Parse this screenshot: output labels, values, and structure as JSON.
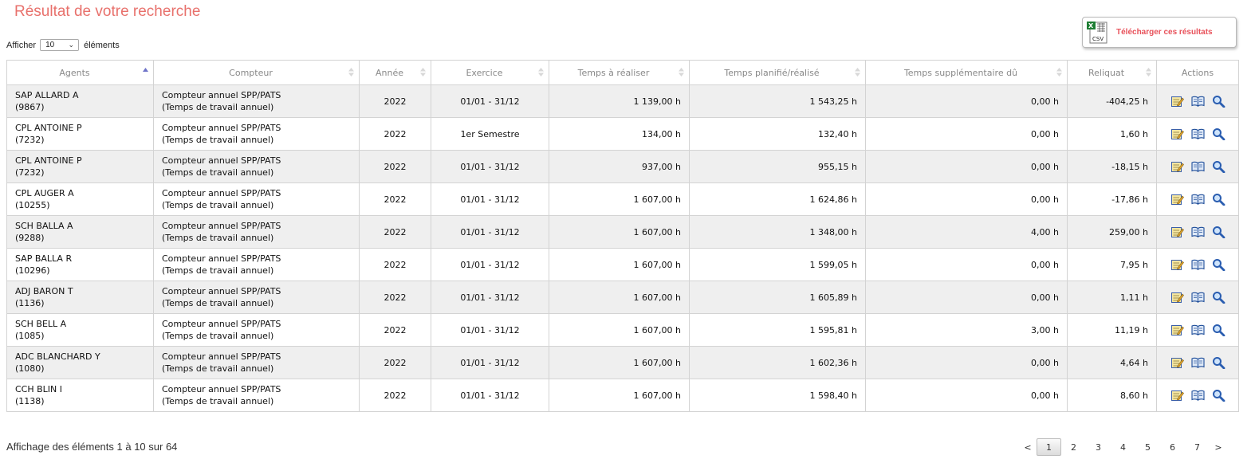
{
  "page": {
    "title": "Résultat de votre recherche"
  },
  "export": {
    "label": "Télécharger ces résultats",
    "icon": "csv-icon"
  },
  "length": {
    "prefix": "Afficher",
    "value": "10",
    "suffix": "éléments"
  },
  "table": {
    "headers": {
      "agents": "Agents",
      "compteur": "Compteur",
      "annee": "Année",
      "exercice": "Exercice",
      "temps_realiser": "Temps à réaliser",
      "temps_planifie": "Temps planifié/réalisé",
      "temps_supp": "Temps supplémentaire dû",
      "reliquat": "Reliquat",
      "actions": "Actions"
    },
    "sorted_column": "agents",
    "sort_direction": "ascending",
    "rows": [
      {
        "agent_name": "SAP ALLARD A",
        "agent_id": "(9867)",
        "compteur_1": "Compteur annuel SPP/PATS",
        "compteur_2": "(Temps de travail annuel)",
        "annee": "2022",
        "exercice": "01/01 - 31/12",
        "temps_realiser": "1 139,00 h",
        "temps_planifie": "1 543,25 h",
        "temps_supp": "0,00 h",
        "reliquat": "-404,25 h"
      },
      {
        "agent_name": "CPL ANTOINE P",
        "agent_id": "(7232)",
        "compteur_1": "Compteur annuel SPP/PATS",
        "compteur_2": "(Temps de travail annuel)",
        "annee": "2022",
        "exercice": "1er Semestre",
        "temps_realiser": "134,00 h",
        "temps_planifie": "132,40 h",
        "temps_supp": "0,00 h",
        "reliquat": "1,60 h"
      },
      {
        "agent_name": "CPL ANTOINE P",
        "agent_id": "(7232)",
        "compteur_1": "Compteur annuel SPP/PATS",
        "compteur_2": "(Temps de travail annuel)",
        "annee": "2022",
        "exercice": "01/01 - 31/12",
        "temps_realiser": "937,00 h",
        "temps_planifie": "955,15 h",
        "temps_supp": "0,00 h",
        "reliquat": "-18,15 h"
      },
      {
        "agent_name": "CPL AUGER A",
        "agent_id": "(10255)",
        "compteur_1": "Compteur annuel SPP/PATS",
        "compteur_2": "(Temps de travail annuel)",
        "annee": "2022",
        "exercice": "01/01 - 31/12",
        "temps_realiser": "1 607,00 h",
        "temps_planifie": "1 624,86 h",
        "temps_supp": "0,00 h",
        "reliquat": "-17,86 h"
      },
      {
        "agent_name": "SCH BALLA A",
        "agent_id": "(9288)",
        "compteur_1": "Compteur annuel SPP/PATS",
        "compteur_2": "(Temps de travail annuel)",
        "annee": "2022",
        "exercice": "01/01 - 31/12",
        "temps_realiser": "1 607,00 h",
        "temps_planifie": "1 348,00 h",
        "temps_supp": "4,00 h",
        "reliquat": "259,00 h"
      },
      {
        "agent_name": "SAP BALLA R",
        "agent_id": "(10296)",
        "compteur_1": "Compteur annuel SPP/PATS",
        "compteur_2": "(Temps de travail annuel)",
        "annee": "2022",
        "exercice": "01/01 - 31/12",
        "temps_realiser": "1 607,00 h",
        "temps_planifie": "1 599,05 h",
        "temps_supp": "0,00 h",
        "reliquat": "7,95 h"
      },
      {
        "agent_name": "ADJ BARON T",
        "agent_id": "(1136)",
        "compteur_1": "Compteur annuel SPP/PATS",
        "compteur_2": "(Temps de travail annuel)",
        "annee": "2022",
        "exercice": "01/01 - 31/12",
        "temps_realiser": "1 607,00 h",
        "temps_planifie": "1 605,89 h",
        "temps_supp": "0,00 h",
        "reliquat": "1,11 h"
      },
      {
        "agent_name": "SCH BELL A",
        "agent_id": "(1085)",
        "compteur_1": "Compteur annuel SPP/PATS",
        "compteur_2": "(Temps de travail annuel)",
        "annee": "2022",
        "exercice": "01/01 - 31/12",
        "temps_realiser": "1 607,00 h",
        "temps_planifie": "1 595,81 h",
        "temps_supp": "3,00 h",
        "reliquat": "11,19 h"
      },
      {
        "agent_name": "ADC BLANCHARD Y",
        "agent_id": "(1080)",
        "compteur_1": "Compteur annuel SPP/PATS",
        "compteur_2": "(Temps de travail annuel)",
        "annee": "2022",
        "exercice": "01/01 - 31/12",
        "temps_realiser": "1 607,00 h",
        "temps_planifie": "1 602,36 h",
        "temps_supp": "0,00 h",
        "reliquat": "4,64 h"
      },
      {
        "agent_name": "CCH BLIN I",
        "agent_id": "(1138)",
        "compteur_1": "Compteur annuel SPP/PATS",
        "compteur_2": "(Temps de travail annuel)",
        "annee": "2022",
        "exercice": "01/01 - 31/12",
        "temps_realiser": "1 607,00 h",
        "temps_planifie": "1 598,40 h",
        "temps_supp": "0,00 h",
        "reliquat": "8,60 h"
      }
    ],
    "row_actions": [
      "edit-note-icon",
      "book-icon",
      "magnifier-icon"
    ]
  },
  "footer": {
    "info": "Affichage des éléments 1 à 10 sur 64",
    "pagination": {
      "prev": "<",
      "next": ">",
      "pages": [
        "1",
        "2",
        "3",
        "4",
        "5",
        "6",
        "7"
      ],
      "current": "1"
    }
  },
  "colors": {
    "title": "#e8716c",
    "export_label": "#e8525b",
    "row_stripe": "#efefef",
    "border": "#d3d3d3",
    "header_text": "#888888",
    "sort_active": "#6f74c9"
  }
}
